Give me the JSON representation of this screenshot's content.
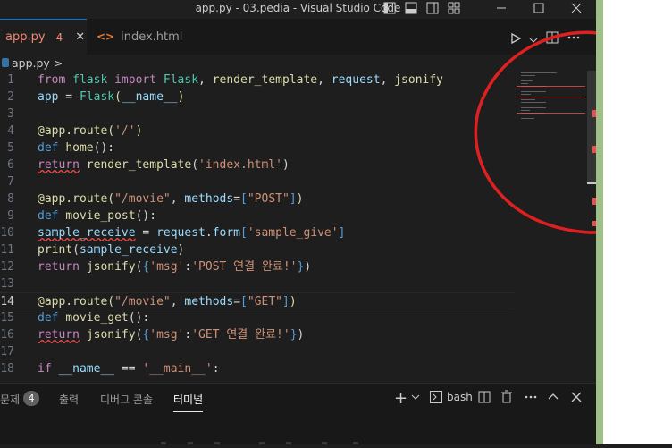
{
  "window": {
    "title": "app.py - 03.pedia - Visual Studio Code"
  },
  "tabs": [
    {
      "label": "app.py",
      "badge": "4"
    },
    {
      "label": "index.html"
    }
  ],
  "breadcrumb": {
    "file": "app.py",
    "sep": ">"
  },
  "editor": {
    "current_line": 14,
    "lines": [
      {
        "n": "1",
        "tokens": [
          [
            "kw2",
            "from "
          ],
          [
            "cls",
            "flask "
          ],
          [
            "kw2",
            "import "
          ],
          [
            "cls",
            "Flask"
          ],
          [
            "plain",
            ", "
          ],
          [
            "fn",
            "render_template"
          ],
          [
            "plain",
            ", "
          ],
          [
            "var",
            "request"
          ],
          [
            "plain",
            ", "
          ],
          [
            "fn",
            "jsonify"
          ]
        ]
      },
      {
        "n": "2",
        "tokens": [
          [
            "var",
            "app"
          ],
          [
            "plain",
            " = "
          ],
          [
            "cls",
            "Flask"
          ],
          [
            "fn",
            "("
          ],
          [
            "var",
            "__name__"
          ],
          [
            "fn",
            ")"
          ]
        ]
      },
      {
        "n": "3",
        "tokens": []
      },
      {
        "n": "4",
        "tokens": [
          [
            "dec",
            "@app.route"
          ],
          [
            "fn",
            "("
          ],
          [
            "str",
            "'/'"
          ],
          [
            "fn",
            ")"
          ]
        ]
      },
      {
        "n": "5",
        "tokens": [
          [
            "kw",
            "def "
          ],
          [
            "fn",
            "home"
          ],
          [
            "plain",
            "():"
          ]
        ]
      },
      {
        "n": "6",
        "tokens": [
          [
            "kw2 squig",
            "return"
          ],
          [
            "plain",
            " "
          ],
          [
            "fn",
            "render_template"
          ],
          [
            "plain",
            "("
          ],
          [
            "str",
            "'index.html'"
          ],
          [
            "plain",
            ")"
          ]
        ]
      },
      {
        "n": "7",
        "tokens": []
      },
      {
        "n": "8",
        "tokens": [
          [
            "dec",
            "@app.route"
          ],
          [
            "fn",
            "("
          ],
          [
            "str",
            "\"/movie\""
          ],
          [
            "plain",
            ", "
          ],
          [
            "var",
            "methods"
          ],
          [
            "plain",
            "="
          ],
          [
            "kw",
            "["
          ],
          [
            "str",
            "\"POST\""
          ],
          [
            "kw",
            "]"
          ],
          [
            "fn",
            ")"
          ]
        ]
      },
      {
        "n": "9",
        "tokens": [
          [
            "kw",
            "def "
          ],
          [
            "fn",
            "movie_post"
          ],
          [
            "plain",
            "():"
          ]
        ]
      },
      {
        "n": "10",
        "tokens": [
          [
            "var squig",
            "sample_receive"
          ],
          [
            "plain",
            " = "
          ],
          [
            "var",
            "request"
          ],
          [
            "plain",
            "."
          ],
          [
            "var",
            "form"
          ],
          [
            "kw",
            "["
          ],
          [
            "str",
            "'sample_give'"
          ],
          [
            "kw",
            "]"
          ]
        ]
      },
      {
        "n": "11",
        "tokens": [
          [
            "fn",
            "print"
          ],
          [
            "plain",
            "("
          ],
          [
            "var",
            "sample_receive"
          ],
          [
            "plain",
            ")"
          ]
        ]
      },
      {
        "n": "12",
        "tokens": [
          [
            "kw2",
            "return "
          ],
          [
            "fn",
            "jsonify"
          ],
          [
            "plain",
            "("
          ],
          [
            "kw",
            "{"
          ],
          [
            "str",
            "'msg'"
          ],
          [
            "plain",
            ":"
          ],
          [
            "str",
            "'POST 연결 완료!'"
          ],
          [
            "kw",
            "}"
          ],
          [
            "plain",
            ")"
          ]
        ]
      },
      {
        "n": "13",
        "tokens": []
      },
      {
        "n": "14",
        "tokens": [
          [
            "dec",
            "@app.route"
          ],
          [
            "fn",
            "("
          ],
          [
            "str",
            "\"/movie\""
          ],
          [
            "plain",
            ", "
          ],
          [
            "var",
            "methods"
          ],
          [
            "plain",
            "="
          ],
          [
            "kw",
            "["
          ],
          [
            "str",
            "\"GET\""
          ],
          [
            "kw",
            "]"
          ],
          [
            "fn",
            ")"
          ]
        ]
      },
      {
        "n": "15",
        "tokens": [
          [
            "kw",
            "def "
          ],
          [
            "fn",
            "movie_get"
          ],
          [
            "plain",
            "():"
          ]
        ]
      },
      {
        "n": "16",
        "tokens": [
          [
            "kw2 squig",
            "return"
          ],
          [
            "plain",
            " "
          ],
          [
            "fn",
            "jsonify"
          ],
          [
            "plain",
            "("
          ],
          [
            "kw",
            "{"
          ],
          [
            "str",
            "'msg'"
          ],
          [
            "plain",
            ":"
          ],
          [
            "str",
            "'GET 연결 완료!'"
          ],
          [
            "kw",
            "}"
          ],
          [
            "plain",
            ")"
          ]
        ]
      },
      {
        "n": "17",
        "tokens": []
      },
      {
        "n": "18",
        "tokens": [
          [
            "kw2",
            "if "
          ],
          [
            "var",
            "__name__"
          ],
          [
            "plain",
            " == "
          ],
          [
            "str",
            "'__main__'"
          ],
          [
            "plain",
            ":"
          ]
        ]
      }
    ]
  },
  "panel": {
    "tabs": [
      {
        "label": "문제",
        "badge": "4"
      },
      {
        "label": "출력"
      },
      {
        "label": "디버그 콘솔"
      },
      {
        "label": "터미널"
      }
    ],
    "terminal_shell": "bash"
  },
  "colors": {
    "annotation": "#e02020",
    "accent": "#0078d4",
    "error": "#f14c4c"
  }
}
